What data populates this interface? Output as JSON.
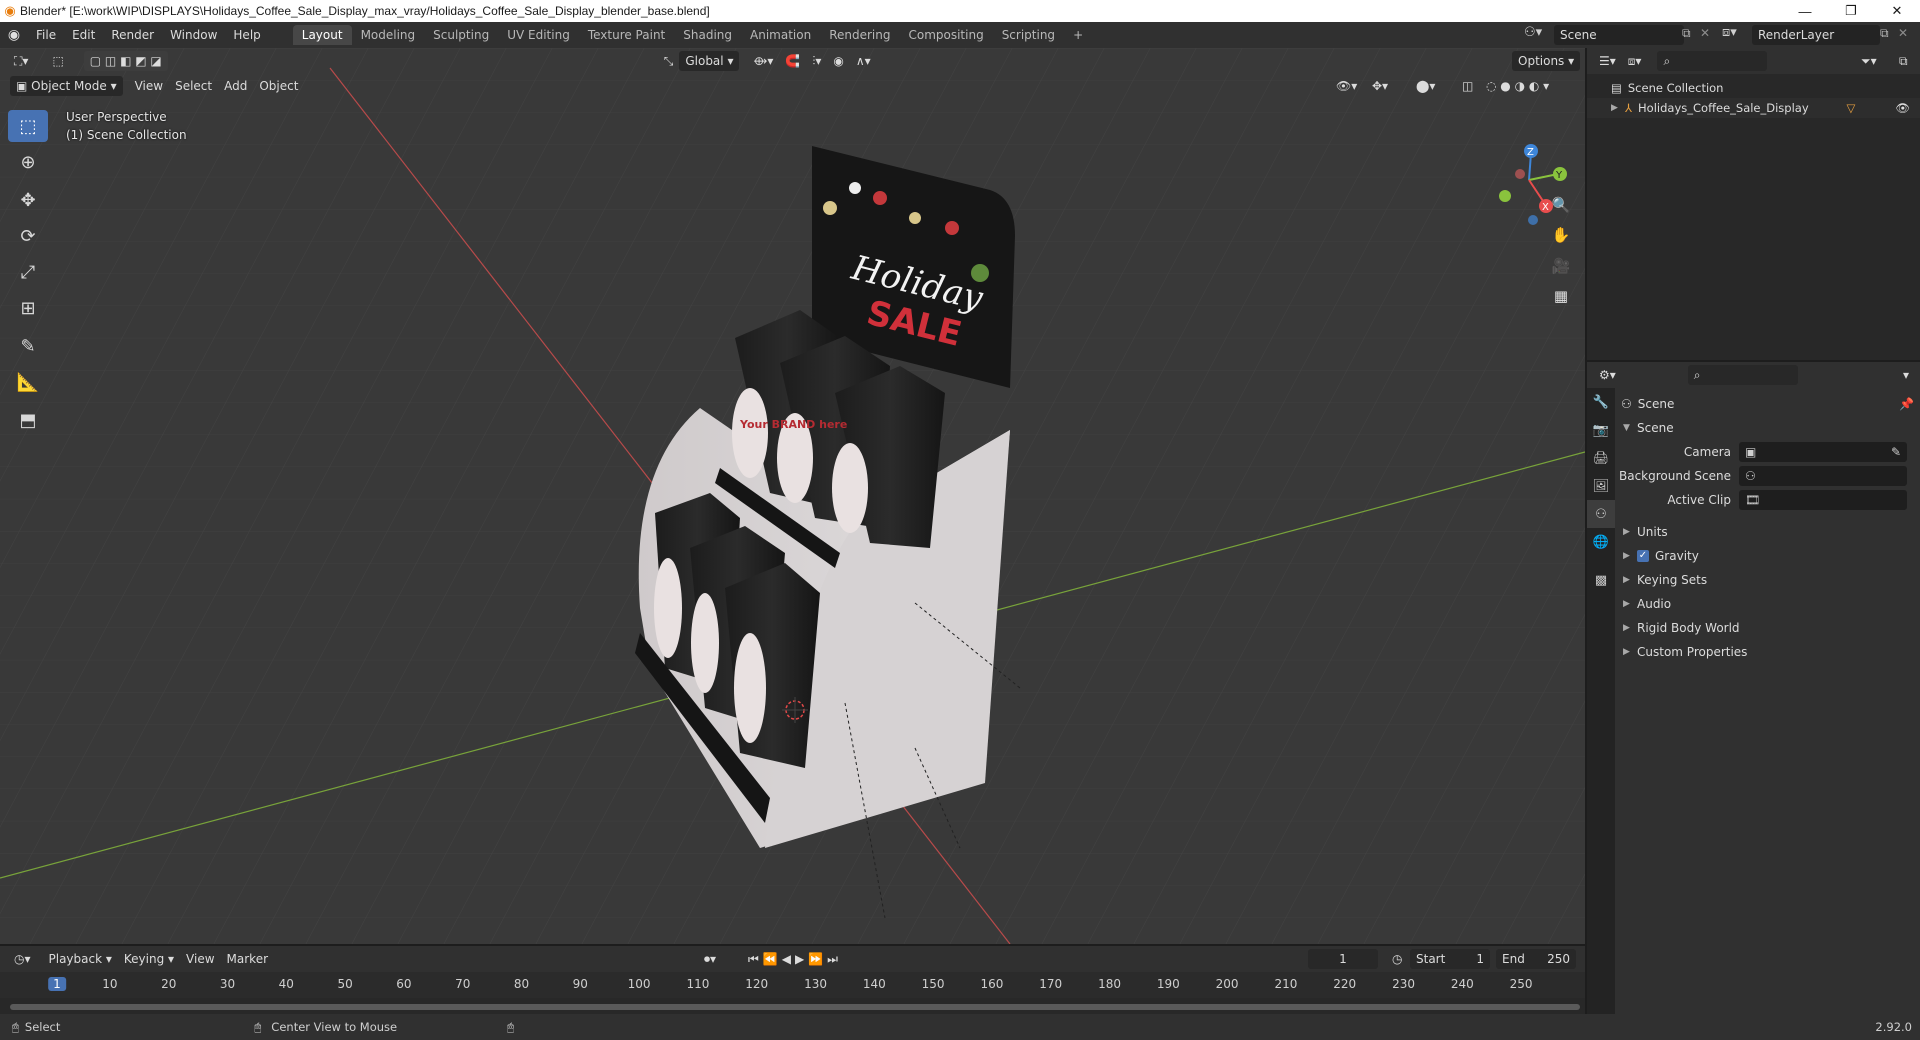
{
  "window": {
    "title": "Blender* [E:\\work\\WIP\\DISPLAYS\\Holidays_Coffee_Sale_Display_max_vray/Holidays_Coffee_Sale_Display_blender_base.blend]",
    "minimize": "—",
    "maximize": "❐",
    "close": "✕"
  },
  "menu": [
    "File",
    "Edit",
    "Render",
    "Window",
    "Help"
  ],
  "workspaces": [
    "Layout",
    "Modeling",
    "Sculpting",
    "UV Editing",
    "Texture Paint",
    "Shading",
    "Animation",
    "Rendering",
    "Compositing",
    "Scripting"
  ],
  "active_workspace": "Layout",
  "scene_name": "Scene",
  "view_layer": "RenderLayer",
  "viewport": {
    "orientation": "Global",
    "options_label": "Options",
    "mode": "Object Mode",
    "header_menus": [
      "View",
      "Select",
      "Add",
      "Object"
    ],
    "perspective_label": "User Perspective",
    "collection_label": "(1) Scene Collection",
    "display_texts": {
      "top": "Holiday",
      "sale": "SALE",
      "brand": "Your BRAND here"
    },
    "gizmo_axes": {
      "z": "Z",
      "y": "Y",
      "x": "X"
    }
  },
  "outliner": {
    "root": "Scene Collection",
    "items": [
      {
        "name": "Holidays_Coffee_Sale_Display"
      }
    ]
  },
  "properties": {
    "context": "Scene",
    "panel": "Scene",
    "fields": [
      {
        "label": "Camera",
        "value": ""
      },
      {
        "label": "Background Scene",
        "value": ""
      },
      {
        "label": "Active Clip",
        "value": ""
      }
    ],
    "subpanels": [
      "Units",
      "Gravity",
      "Keying Sets",
      "Audio",
      "Rigid Body World",
      "Custom Properties"
    ],
    "gravity_enabled": true
  },
  "timeline": {
    "menus": [
      "Playback",
      "Keying",
      "View",
      "Marker"
    ],
    "current_frame": "1",
    "start_label": "Start",
    "start": "1",
    "end_label": "End",
    "end": "250",
    "ruler": [
      "1",
      "10",
      "20",
      "30",
      "40",
      "50",
      "60",
      "70",
      "80",
      "90",
      "100",
      "110",
      "120",
      "130",
      "140",
      "150",
      "160",
      "170",
      "180",
      "190",
      "200",
      "210",
      "220",
      "230",
      "240",
      "250"
    ]
  },
  "status": {
    "select": "Select",
    "center_view": "Center View to Mouse",
    "version": "2.92.0"
  },
  "colors": {
    "accent": "#4772b3",
    "x_axis": "#e84d4d",
    "y_axis": "#8ac33d",
    "z_axis": "#3e86d9"
  }
}
